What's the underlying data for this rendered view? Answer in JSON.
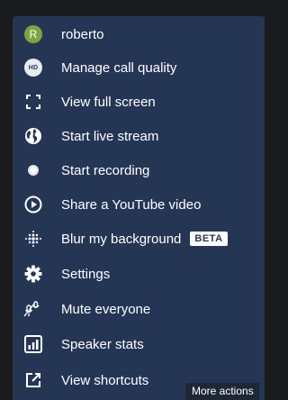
{
  "menu": {
    "items": [
      {
        "label": "roberto",
        "icon": "avatar",
        "avatar_initial": "R"
      },
      {
        "label": "Manage call quality",
        "icon": "hd-icon",
        "hd_text": "HD"
      },
      {
        "label": "View full screen",
        "icon": "fullscreen-icon"
      },
      {
        "label": "Start live stream",
        "icon": "globe-icon"
      },
      {
        "label": "Start recording",
        "icon": "record-icon"
      },
      {
        "label": "Share a YouTube video",
        "icon": "play-circle-icon"
      },
      {
        "label": "Blur my background",
        "icon": "blur-icon",
        "badge": "BETA"
      },
      {
        "label": "Settings",
        "icon": "gear-icon"
      },
      {
        "label": "Mute everyone",
        "icon": "mute-everyone-icon"
      },
      {
        "label": "Speaker stats",
        "icon": "stats-icon"
      },
      {
        "label": "View shortcuts",
        "icon": "external-link-icon"
      }
    ]
  },
  "tooltip": {
    "text": "More actions"
  },
  "colors": {
    "menu_bg": "#253654",
    "avatar_bg": "#7fa33f",
    "text": "#ffffff"
  }
}
